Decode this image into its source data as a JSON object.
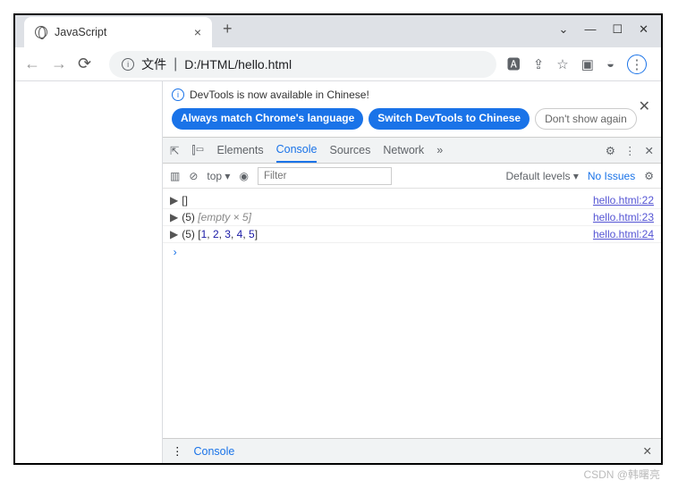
{
  "window": {
    "min": "—",
    "max": "☐",
    "close": "✕",
    "dropdown": "⌄"
  },
  "tab": {
    "title": "JavaScript",
    "close": "×"
  },
  "addr": {
    "file_label": "文件",
    "path": "D:/HTML/hello.html"
  },
  "banner": {
    "msg": "DevTools is now available in Chinese!",
    "btn1": "Always match Chrome's language",
    "btn2": "Switch DevTools to Chinese",
    "btn3": "Don't show again"
  },
  "devtabs": {
    "elements": "Elements",
    "console": "Console",
    "sources": "Sources",
    "network": "Network",
    "more": "»"
  },
  "toolbar": {
    "top": "top",
    "filter_ph": "Filter",
    "levels": "Default levels",
    "noissues": "No Issues"
  },
  "logs": [
    {
      "expand": "▶",
      "body": "[]",
      "link": "hello.html:22"
    },
    {
      "expand": "▶",
      "body": "(5) [empty × 5]",
      "link": "hello.html:23",
      "gray": true
    },
    {
      "expand": "▶",
      "body": "(5) [1, 2, 3, 4, 5]",
      "link": "hello.html:24",
      "nums": true
    }
  ],
  "drawer": {
    "console": "Console"
  },
  "watermark": "CSDN @韩曙亮"
}
